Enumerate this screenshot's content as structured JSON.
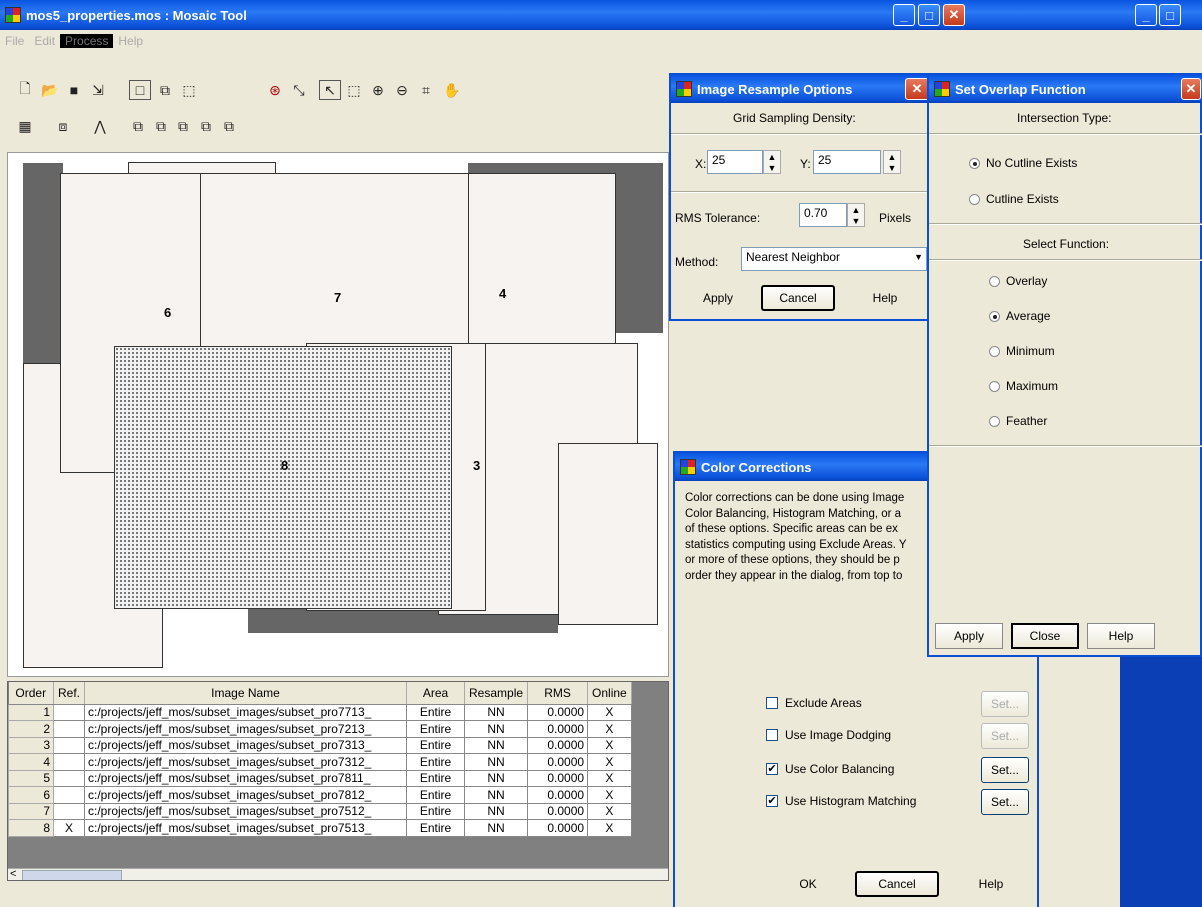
{
  "main_window": {
    "title": "mos5_properties.mos : Mosaic Tool",
    "menu": [
      "File",
      "Edit",
      "Process",
      "Help"
    ]
  },
  "toolbar_icons_row1": [
    "new-file-icon",
    "open-folder-icon",
    "save-icon",
    "export-icon",
    "single-view-icon",
    "dual-view-icon",
    "select-area-icon",
    "color-target-icon",
    "fit-to-window-icon",
    "pointer-icon",
    "box-select-icon",
    "zoom-in-icon",
    "zoom-out-icon",
    "crop-icon",
    "pan-hand-icon"
  ],
  "toolbar_icons_row2": [
    "table-icon",
    "layers-icon",
    "histogram-icon",
    "stack-front-icon",
    "stack-back-icon",
    "stack-up-icon",
    "stack-down-icon",
    "stack-reverse-icon"
  ],
  "canvas": {
    "tiles": [
      {
        "id": "6",
        "label": "6"
      },
      {
        "id": "7",
        "label": "7"
      },
      {
        "id": "4",
        "label": "4"
      },
      {
        "id": "3",
        "label": "3"
      },
      {
        "id": "8",
        "label": "8"
      }
    ]
  },
  "image_table": {
    "columns": [
      "Order",
      "Ref.",
      "Image Name",
      "Area",
      "Resample",
      "RMS",
      "Online"
    ],
    "rows": [
      {
        "order": "1",
        "ref": "",
        "name": "c:/projects/jeff_mos/subset_images/subset_pro7713_",
        "area": "Entire",
        "resample": "NN",
        "rms": "0.0000",
        "online": "X"
      },
      {
        "order": "2",
        "ref": "",
        "name": "c:/projects/jeff_mos/subset_images/subset_pro7213_",
        "area": "Entire",
        "resample": "NN",
        "rms": "0.0000",
        "online": "X"
      },
      {
        "order": "3",
        "ref": "",
        "name": "c:/projects/jeff_mos/subset_images/subset_pro7313_",
        "area": "Entire",
        "resample": "NN",
        "rms": "0.0000",
        "online": "X"
      },
      {
        "order": "4",
        "ref": "",
        "name": "c:/projects/jeff_mos/subset_images/subset_pro7312_",
        "area": "Entire",
        "resample": "NN",
        "rms": "0.0000",
        "online": "X"
      },
      {
        "order": "5",
        "ref": "",
        "name": "c:/projects/jeff_mos/subset_images/subset_pro7811_",
        "area": "Entire",
        "resample": "NN",
        "rms": "0.0000",
        "online": "X"
      },
      {
        "order": "6",
        "ref": "",
        "name": "c:/projects/jeff_mos/subset_images/subset_pro7812_",
        "area": "Entire",
        "resample": "NN",
        "rms": "0.0000",
        "online": "X"
      },
      {
        "order": "7",
        "ref": "",
        "name": "c:/projects/jeff_mos/subset_images/subset_pro7512_",
        "area": "Entire",
        "resample": "NN",
        "rms": "0.0000",
        "online": "X"
      },
      {
        "order": "8",
        "ref": "X",
        "name": "c:/projects/jeff_mos/subset_images/subset_pro7513_",
        "area": "Entire",
        "resample": "NN",
        "rms": "0.0000",
        "online": "X"
      }
    ]
  },
  "resample_dialog": {
    "title": "Image Resample Options",
    "section": "Grid Sampling Density:",
    "x_label": "X:",
    "x_value": "25",
    "y_label": "Y:",
    "y_value": "25",
    "rms_label": "RMS Tolerance:",
    "rms_value": "0.70",
    "rms_unit": "Pixels",
    "method_label": "Method:",
    "method_value": "Nearest Neighbor",
    "apply": "Apply",
    "cancel": "Cancel",
    "help": "Help"
  },
  "overlap_dialog": {
    "title": "Set Overlap Function",
    "intersection_heading": "Intersection Type:",
    "intersection_options": [
      "No Cutline Exists",
      "Cutline Exists"
    ],
    "intersection_selected": "No Cutline Exists",
    "function_heading": "Select Function:",
    "function_options": [
      "Overlay",
      "Average",
      "Minimum",
      "Maximum",
      "Feather"
    ],
    "function_selected": "Average",
    "apply": "Apply",
    "close": "Close",
    "help": "Help"
  },
  "color_dialog": {
    "title": "Color Corrections",
    "desc_lines": [
      "Color corrections can be done using Image",
      "Color Balancing, Histogram Matching, or a",
      "of these options. Specific areas can be ex",
      "statistics computing using Exclude Areas. Y",
      "or more of these options, they should be p",
      "order they appear in the dialog, from top to"
    ],
    "options": [
      {
        "label": "Exclude Areas",
        "checked": false,
        "set_label": "Set...",
        "set_enabled": false
      },
      {
        "label": "Use Image Dodging",
        "checked": false,
        "set_label": "Set...",
        "set_enabled": false
      },
      {
        "label": "Use Color Balancing",
        "checked": true,
        "set_label": "Set...",
        "set_enabled": true
      },
      {
        "label": "Use Histogram Matching",
        "checked": true,
        "set_label": "Set...",
        "set_enabled": true
      }
    ],
    "ok": "OK",
    "cancel": "Cancel",
    "help": "Help"
  }
}
